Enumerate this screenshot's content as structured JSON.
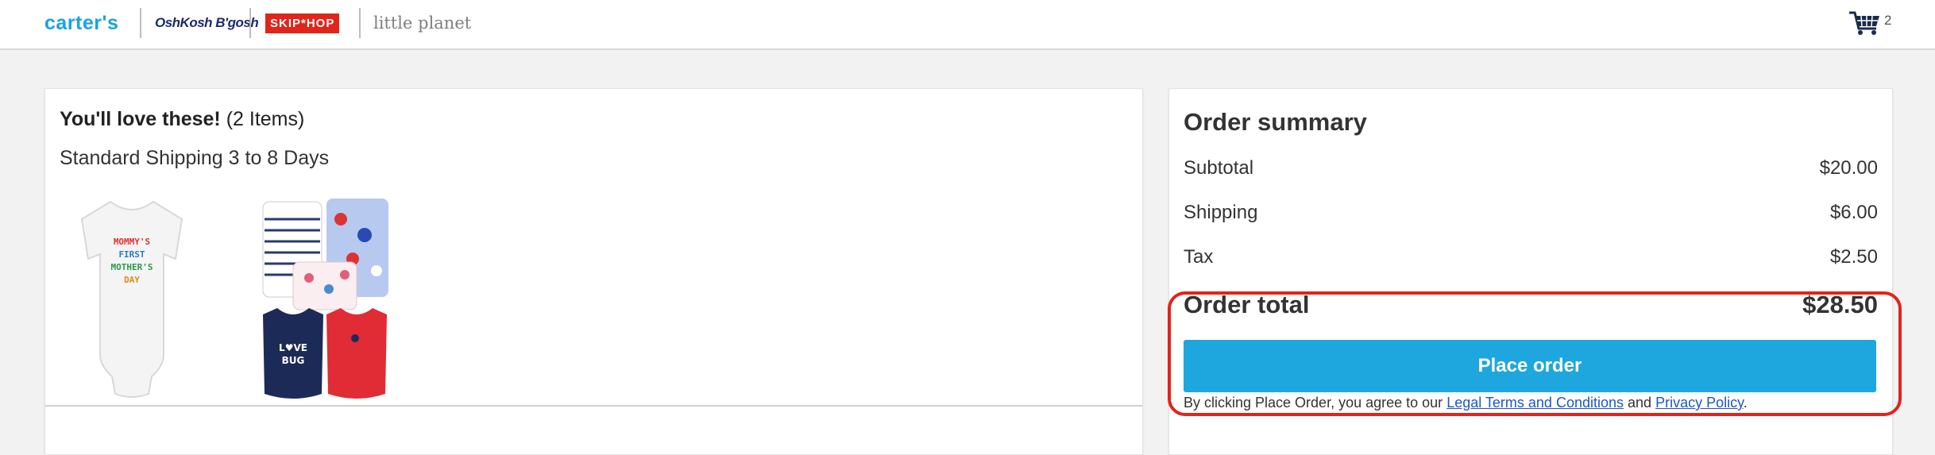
{
  "header": {
    "brands": {
      "carters": "carter's",
      "oshkosh": "OshKosh B'gosh",
      "skiphop": "SKIP*HOP",
      "littleplanet": "little planet"
    },
    "cart_count": "2",
    "cart_icon": "shopping-cart-icon"
  },
  "items_panel": {
    "heading_bold": "You'll love these!",
    "heading_count": "(2 Items)",
    "shipping": "Standard Shipping 3 to 8 Days",
    "products": [
      {
        "print_text": "MOMMY'S FIRST MOTHER'S DAY"
      },
      {
        "print_text": "LOVE BUG"
      }
    ]
  },
  "summary": {
    "title": "Order summary",
    "rows": [
      {
        "label": "Subtotal",
        "value": "$20.00"
      },
      {
        "label": "Shipping",
        "value": "$6.00"
      },
      {
        "label": "Tax",
        "value": "$2.50"
      }
    ],
    "total_label": "Order total",
    "total_value": "$28.50",
    "place_order": "Place order",
    "legal_prefix": "By clicking Place Order, you agree to our",
    "legal_terms": "Legal Terms and Conditions",
    "legal_and": "and",
    "legal_privacy": "Privacy Policy",
    "legal_suffix": "."
  },
  "colors": {
    "accent": "#1ea6df",
    "highlight": "#e2231a",
    "link": "#1a56c9"
  }
}
